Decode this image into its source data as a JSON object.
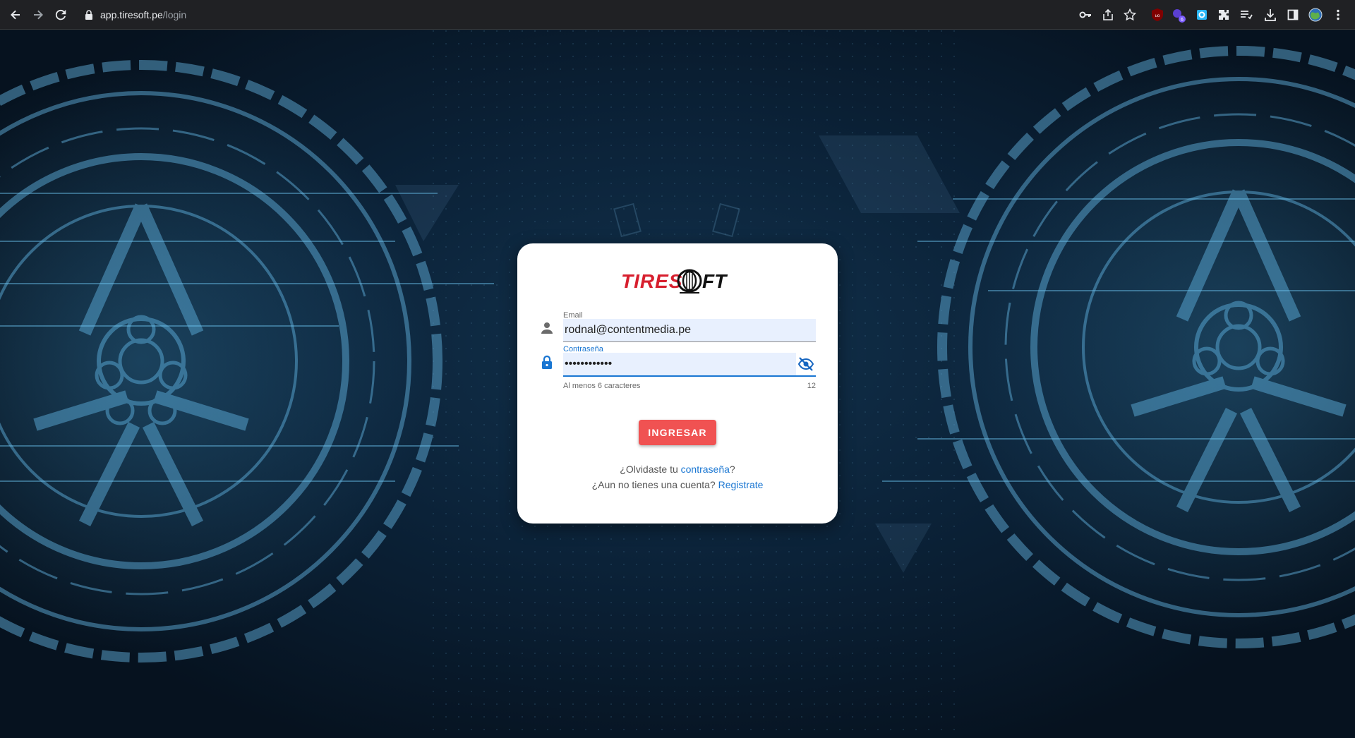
{
  "browser": {
    "url_host": "app.tiresoft.pe",
    "url_path": "/login",
    "extension_badge": "6"
  },
  "login": {
    "logo_text": "TIRESOFT",
    "email_label": "Email",
    "email_value": "rodnal@contentmedia.pe",
    "password_label": "Contraseña",
    "password_value": "••••••••••••",
    "password_hint": "Al menos 6 caracteres",
    "password_count": "12",
    "submit_label": "INGRESAR",
    "forgot_prefix": "¿Olvidaste tu ",
    "forgot_link": "contraseña",
    "forgot_suffix": "?",
    "register_prefix": "¿Aun no tienes una cuenta? ",
    "register_link": "Registrate"
  },
  "colors": {
    "accent": "#1976d2",
    "button": "#f05252",
    "logo_red": "#d71f2e",
    "input_bg": "#e8f0fe"
  },
  "icons": [
    "back-icon",
    "forward-icon",
    "reload-icon",
    "lock-icon",
    "key-icon",
    "share-icon",
    "star-icon",
    "ublock-icon",
    "extension-icon",
    "puzzle-icon",
    "reading-list-icon",
    "download-icon",
    "side-panel-icon",
    "profile-icon",
    "menu-icon",
    "person-icon",
    "padlock-icon",
    "visibility-off-icon"
  ]
}
